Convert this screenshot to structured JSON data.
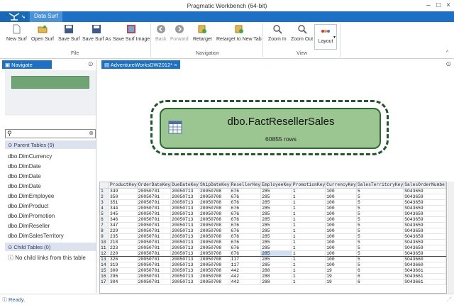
{
  "window": {
    "title": "Pragmatic Workbench (64-bit)"
  },
  "menu": {
    "tab": "Data Surf"
  },
  "ribbon": {
    "file": {
      "group": "File",
      "new": "New Surf",
      "open": "Open Surf",
      "save": "Save Surf",
      "save_as": "Save Surf As",
      "save_image": "Save Surf Image"
    },
    "navigation": {
      "group": "Navigation",
      "back": "Back",
      "forward": "Forward",
      "retarget": "Retarget",
      "retarget_new": "Retarget to New Tab"
    },
    "view": {
      "group": "View",
      "zoom_in": "Zoom In",
      "zoom_out": "Zoom Out",
      "layout": "Layout"
    }
  },
  "navigate": {
    "tab": "Navigate",
    "parent_header": "Parent Tables (9)",
    "parent_tables": [
      "dbo.DimCurrency",
      "dbo.DimDate",
      "dbo.DimDate",
      "dbo.DimDate",
      "dbo.DimEmployee",
      "dbo.DimProduct",
      "dbo.DimPromotion",
      "dbo.DimReseller",
      "dbo.DimSalesTerritory"
    ],
    "child_header": "Child Tables (0)",
    "child_empty": "No child links from this table"
  },
  "document": {
    "tab": "AdventureWorksDW2012*",
    "node_title": "dbo.FactResellerSales",
    "node_rows": "60855 rows"
  },
  "grid": {
    "columns": [
      "ProductKey",
      "OrderDateKey",
      "DueDateKey",
      "ShipDateKey",
      "ResellerKey",
      "EmployeeKey",
      "PromotionKey",
      "CurrencyKey",
      "SalesTerritoryKey",
      "SalesOrderNumbe"
    ],
    "rows": [
      [
        "1",
        "349",
        "20050701",
        "20050713",
        "20050708",
        "676",
        "285",
        "1",
        "100",
        "5",
        "SO43659"
      ],
      [
        "2",
        "350",
        "20050701",
        "20050713",
        "20050708",
        "676",
        "285",
        "1",
        "100",
        "5",
        "SO43659"
      ],
      [
        "3",
        "351",
        "20050701",
        "20050713",
        "20050708",
        "676",
        "285",
        "1",
        "100",
        "5",
        "SO43659"
      ],
      [
        "4",
        "344",
        "20050701",
        "20050713",
        "20050708",
        "676",
        "285",
        "1",
        "100",
        "5",
        "SO43659"
      ],
      [
        "5",
        "345",
        "20050701",
        "20050713",
        "20050708",
        "676",
        "285",
        "1",
        "100",
        "5",
        "SO43659"
      ],
      [
        "6",
        "346",
        "20050701",
        "20050713",
        "20050708",
        "676",
        "285",
        "1",
        "100",
        "5",
        "SO43659"
      ],
      [
        "7",
        "347",
        "20050701",
        "20050713",
        "20050708",
        "676",
        "285",
        "1",
        "100",
        "5",
        "SO43659"
      ],
      [
        "8",
        "229",
        "20050701",
        "20050713",
        "20050708",
        "676",
        "285",
        "1",
        "100",
        "5",
        "SO43659"
      ],
      [
        "9",
        "235",
        "20050701",
        "20050713",
        "20050708",
        "676",
        "285",
        "1",
        "100",
        "5",
        "SO43659"
      ],
      [
        "10",
        "218",
        "20050701",
        "20050713",
        "20050708",
        "676",
        "285",
        "1",
        "100",
        "5",
        "SO43659"
      ],
      [
        "11",
        "223",
        "20050701",
        "20050713",
        "20050708",
        "676",
        "285",
        "1",
        "100",
        "5",
        "SO43659"
      ],
      [
        "12",
        "220",
        "20050701",
        "20050713",
        "20050708",
        "676",
        "285",
        "1",
        "100",
        "5",
        "SO43659"
      ],
      [
        "13",
        "326",
        "20050701",
        "20050713",
        "20050708",
        "117",
        "285",
        "1",
        "100",
        "5",
        "SO43660"
      ],
      [
        "14",
        "319",
        "20050701",
        "20050713",
        "20050708",
        "117",
        "285",
        "1",
        "100",
        "5",
        "SO43660"
      ],
      [
        "15",
        "300",
        "20050701",
        "20050713",
        "20050708",
        "442",
        "288",
        "1",
        "19",
        "6",
        "SO43661"
      ],
      [
        "16",
        "296",
        "20050701",
        "20050713",
        "20050708",
        "442",
        "288",
        "1",
        "19",
        "6",
        "SO43661"
      ],
      [
        "17",
        "304",
        "20050701",
        "20050713",
        "20050708",
        "442",
        "288",
        "1",
        "19",
        "6",
        "SO43661"
      ]
    ],
    "selected_row": 12
  },
  "status": {
    "text": "Ready."
  }
}
